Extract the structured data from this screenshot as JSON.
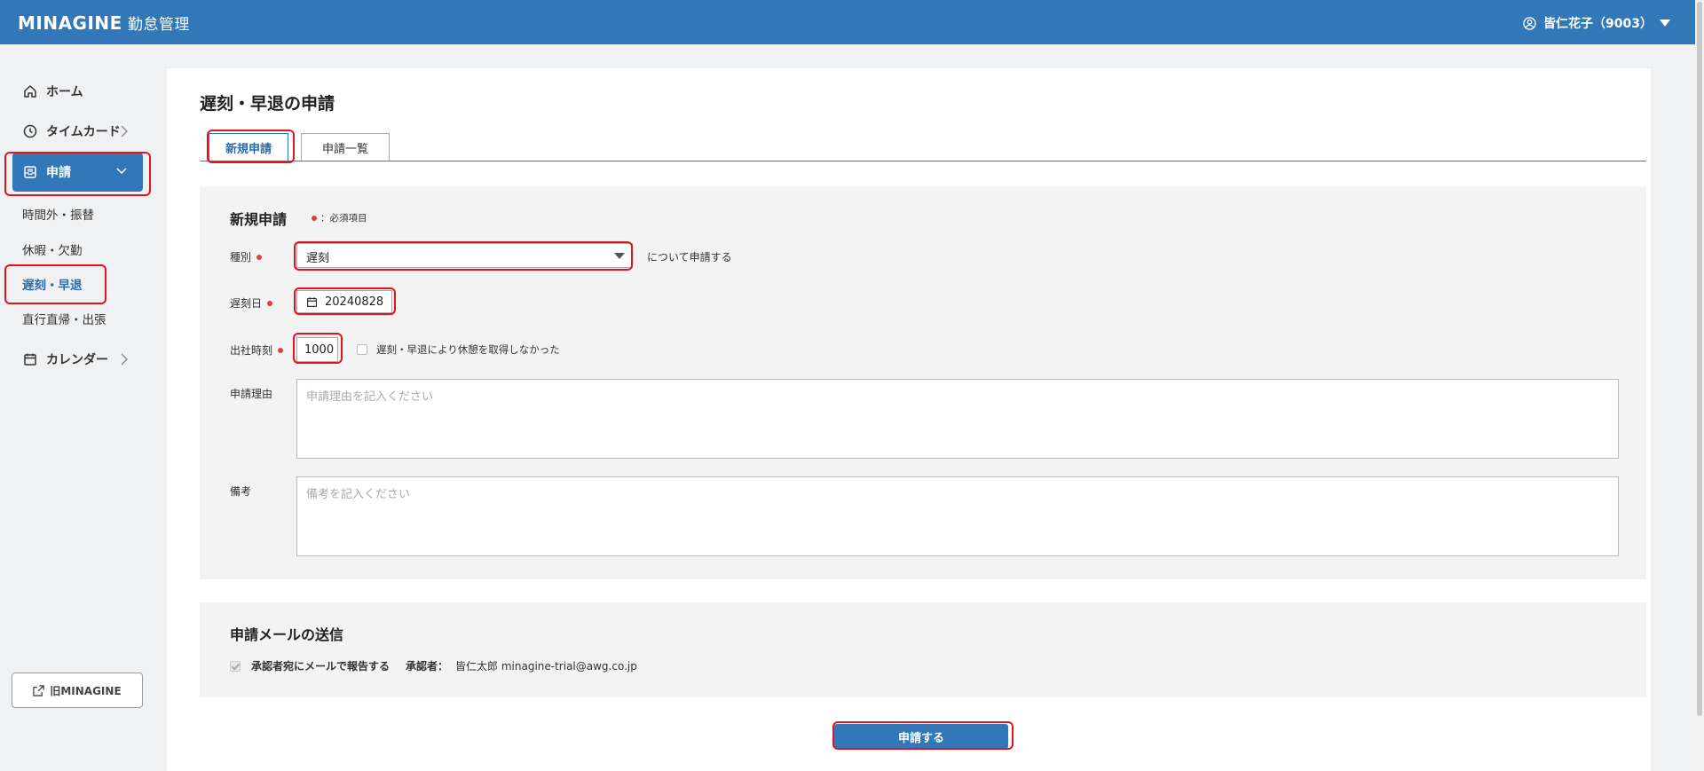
{
  "header": {
    "logo": "MINAGINE",
    "app_name": "勤怠管理",
    "user_name": "皆仁花子（9003）"
  },
  "sidebar": {
    "items": [
      {
        "label": "ホーム"
      },
      {
        "label": "タイムカード"
      },
      {
        "label": "申請"
      },
      {
        "label": "カレンダー"
      }
    ],
    "sub_items": [
      {
        "label": "時間外・振替"
      },
      {
        "label": "休暇・欠勤"
      },
      {
        "label": "遅刻・早退"
      },
      {
        "label": "直行直帰・出張"
      }
    ],
    "old_link": "旧MINAGINE"
  },
  "main": {
    "title": "遅刻・早退の申請",
    "tabs": [
      {
        "label": "新規申請"
      },
      {
        "label": "申請一覧"
      }
    ],
    "form": {
      "section_title": "新規申請",
      "required_note": "：必須項目",
      "type_label": "種別",
      "type_value": "遅刻",
      "type_suffix": "について申請する",
      "date_label": "遅刻日",
      "date_value": "20240828",
      "time_label": "出社時刻",
      "time_value": "1000",
      "no_break_label": "遅刻・早退により休憩を取得しなかった",
      "reason_label": "申請理由",
      "reason_placeholder": "申請理由を記入ください",
      "memo_label": "備考",
      "memo_placeholder": "備考を記入ください"
    },
    "mail": {
      "section_title": "申請メールの送信",
      "notify_label": "承認者宛にメールで報告する",
      "approver_label": "承認者：",
      "approver_value": "皆仁太郎 minagine-trial@awg.co.jp"
    },
    "submit_label": "申請する"
  },
  "colors": {
    "brand": "#3277b8",
    "required_dot": "#e53e3e",
    "highlight": "#e0141e"
  }
}
